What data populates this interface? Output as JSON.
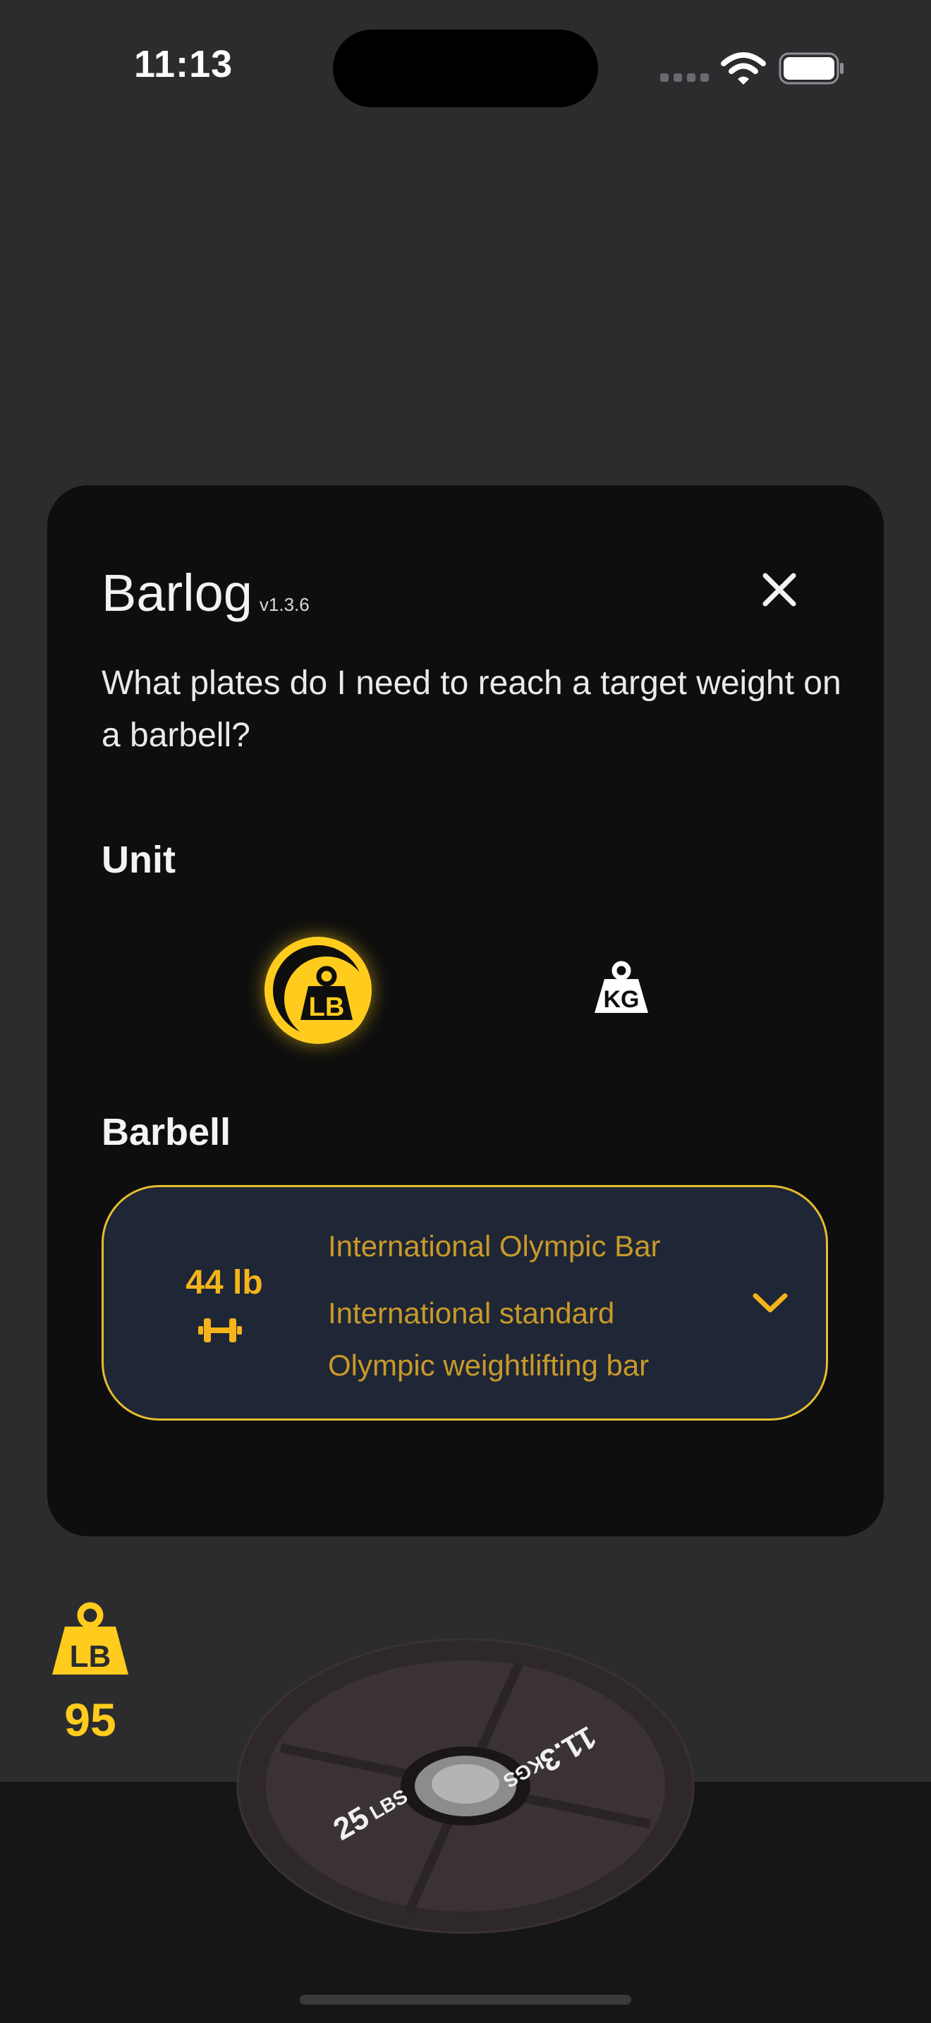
{
  "status_bar": {
    "time": "11:13"
  },
  "modal": {
    "title": "Barlog",
    "version": "v1.3.6",
    "question": "What plates do I need to reach a target weight on a barbell?",
    "unit_label": "Unit",
    "units": [
      {
        "icon": "lb-weight-icon",
        "text": "LB",
        "selected": true
      },
      {
        "icon": "kg-weight-icon",
        "text": "KG",
        "selected": false
      }
    ],
    "barbell_label": "Barbell",
    "barbell": {
      "weight": "44 lb",
      "name": "International Olympic Bar",
      "description": "International standard Olympic weightlifting bar"
    }
  },
  "current": {
    "unit_icon": "lb-weight-icon",
    "unit_text": "LB",
    "weight": "95"
  },
  "plate": {
    "lbs_value": "25",
    "lbs_unit": "LBS",
    "kgs_value": "11.3",
    "kgs_unit": "KGS"
  },
  "colors": {
    "accent": "#ffcc1e",
    "background": "#2c2c2e",
    "modal": "#0e0e0e",
    "select_bg": "#1f2636",
    "select_text": "#c99a28"
  }
}
